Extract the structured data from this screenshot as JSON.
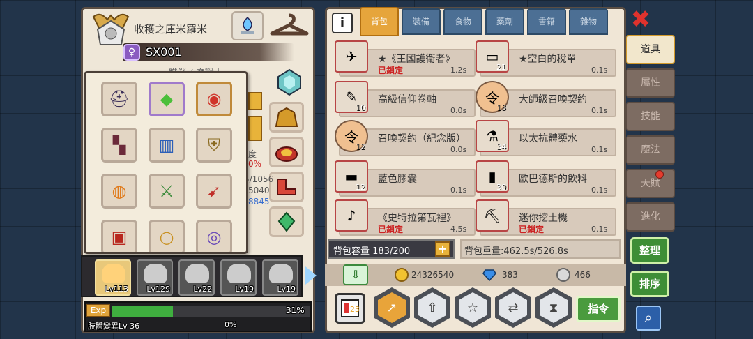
{
  "character": {
    "title": "收穫之庫米羅米",
    "name": "SX001",
    "job_label": "職業 / 魔戰士",
    "stat_fragments": [
      "度",
      "0%",
      "5/1056",
      "5040",
      "8845"
    ]
  },
  "equipment": {
    "slots": [
      {
        "icon": "dark-helmet-icon",
        "glyph": "⛑"
      },
      {
        "icon": "green-gem-icon",
        "glyph": "◆"
      },
      {
        "icon": "ring-icon",
        "glyph": "◉"
      },
      {
        "icon": "cape-icon",
        "glyph": "▚"
      },
      {
        "icon": "blue-armor-icon",
        "glyph": "▥"
      },
      {
        "icon": "shield-icon",
        "glyph": "⛨"
      },
      {
        "icon": "pumpkin-icon",
        "glyph": "◍"
      },
      {
        "icon": "sword-icon",
        "glyph": "⚔"
      },
      {
        "icon": "spear-icon",
        "glyph": "➹"
      },
      {
        "icon": "red-shield-icon",
        "glyph": "▣"
      },
      {
        "icon": "gold-ring-icon",
        "glyph": "○"
      },
      {
        "icon": "purple-bracelet-icon",
        "glyph": "◎"
      }
    ]
  },
  "party": {
    "members": [
      {
        "level": "Lv113"
      },
      {
        "level": "Lv129"
      },
      {
        "level": "Lv22"
      },
      {
        "level": "Lv19"
      },
      {
        "level": "Lv19"
      }
    ]
  },
  "exp": {
    "label": "Exp",
    "percent": "31%",
    "fraction": 0.31,
    "job_exp_label": "肢體變異Lv 36",
    "job_exp_percent": "0%"
  },
  "inventory": {
    "tabs": [
      "背包",
      "裝備",
      "食物",
      "藥劑",
      "書籍",
      "雜物"
    ],
    "active_tab": 0,
    "items": [
      {
        "name": "★《王國護衛者》",
        "locked": "已鎖定",
        "qty": "",
        "weight": "1.2s",
        "icon": "red-crossbow-icon",
        "glyph": "✈"
      },
      {
        "name": "★空白的稅單",
        "locked": "",
        "qty": "21",
        "weight": "0.1s",
        "icon": "tax-form-icon",
        "glyph": "▭"
      },
      {
        "name": "高級信仰卷軸",
        "locked": "",
        "qty": "10",
        "weight": "0.0s",
        "icon": "scroll-icon",
        "glyph": "✎"
      },
      {
        "name": "大師級召喚契約",
        "locked": "",
        "qty": "13",
        "weight": "0.1s",
        "icon": "contract-badge-icon",
        "glyph": "令"
      },
      {
        "name": "\u0000召喚契約（紀念版）",
        "locked": "",
        "qty": "12",
        "weight": "0.0s",
        "icon": "commemorative-contract-icon",
        "glyph": "令"
      },
      {
        "name": "以太抗體藥水",
        "locked": "",
        "qty": "34",
        "weight": "0.1s",
        "icon": "potion-icon",
        "glyph": "⚗"
      },
      {
        "name": "藍色膠囊",
        "locked": "",
        "qty": "12",
        "weight": "0.1s",
        "icon": "capsule-icon",
        "glyph": "▬"
      },
      {
        "name": "歐巴德斯的飲料",
        "locked": "",
        "qty": "30",
        "weight": "0.1s",
        "icon": "drink-icon",
        "glyph": "▮"
      },
      {
        "name": "《史特拉第瓦裡》",
        "locked": "已鎖定",
        "qty": "",
        "weight": "4.5s",
        "icon": "violin-icon",
        "glyph": "♪"
      },
      {
        "name": "迷你挖土機",
        "locked": "已鎖定",
        "qty": "",
        "weight": "0.1s",
        "icon": "excavator-icon",
        "glyph": "⛏"
      }
    ],
    "capacity_label": "背包容量 183/200",
    "weight_label": "背包重量:462.5s/526.8s"
  },
  "currency": {
    "gold": "24326540",
    "diamond": "383",
    "silver": "466"
  },
  "actions": {
    "command_label": "指令",
    "hex_buttons": [
      "bag-sort-icon",
      "upgrade-arrow-icon",
      "star-icon",
      "swap-icon",
      "hourglass-icon"
    ],
    "hex_glyphs": [
      "↗",
      "⇧",
      "☆",
      "⇄",
      "⧗"
    ]
  },
  "side_tabs": [
    {
      "label": "道具",
      "active": true
    },
    {
      "label": "屬性",
      "active": false
    },
    {
      "label": "技能",
      "active": false
    },
    {
      "label": "魔法",
      "active": false
    },
    {
      "label": "天賦",
      "active": false
    },
    {
      "label": "進化",
      "active": false
    }
  ],
  "side_buttons": {
    "tidy": "整理",
    "sort": "排序"
  },
  "colors": {
    "active_tab": "#e6a53c",
    "inactive_tab": "#4c6f94",
    "exp_fill": "#3fae3f",
    "locked_text": "#cc2222",
    "command_button": "#4a9b3e"
  }
}
